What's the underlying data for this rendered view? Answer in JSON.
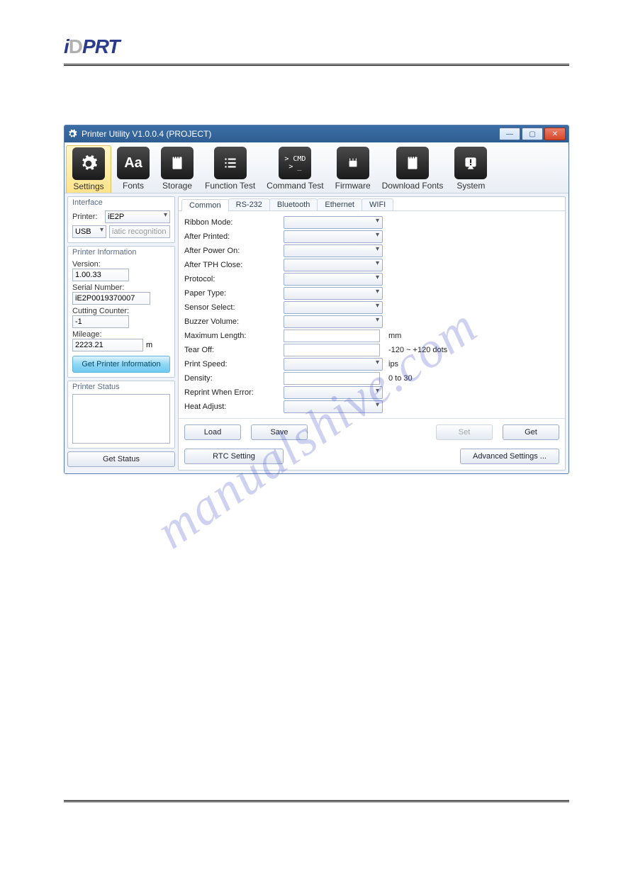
{
  "brand": "iDPRT",
  "title": "Printer Utility  V1.0.0.4  (PROJECT)",
  "watermark": "manualshive.com",
  "toolbar": [
    {
      "key": "settings",
      "label": "Settings"
    },
    {
      "key": "fonts",
      "label": "Fonts"
    },
    {
      "key": "storage",
      "label": "Storage"
    },
    {
      "key": "function_test",
      "label": "Function Test"
    },
    {
      "key": "command_test",
      "label": "Command Test"
    },
    {
      "key": "firmware",
      "label": "Firmware"
    },
    {
      "key": "download_fonts",
      "label": "Download Fonts"
    },
    {
      "key": "system",
      "label": "System"
    }
  ],
  "interface": {
    "title": "Interface",
    "printer_label": "Printer:",
    "printer_value": "iE2P",
    "conn": "USB",
    "conn_hint": "iatic recognition USB"
  },
  "printer_info": {
    "title": "Printer Information",
    "version_label": "Version:",
    "version_value": "1.00.33",
    "serial_label": "Serial Number:",
    "serial_value": "iE2P0019370007",
    "cutting_label": "Cutting Counter:",
    "cutting_value": "-1",
    "mileage_label": "Mileage:",
    "mileage_value": "2223.21",
    "mileage_unit": "m",
    "get_info_btn": "Get Printer Information"
  },
  "status": {
    "title": "Printer Status",
    "get_status_btn": "Get Status"
  },
  "tabs": [
    {
      "label": "Common"
    },
    {
      "label": "RS-232"
    },
    {
      "label": "Bluetooth"
    },
    {
      "label": "Ethernet"
    },
    {
      "label": "WIFI"
    }
  ],
  "fields": [
    {
      "label": "Ribbon Mode:",
      "type": "combo"
    },
    {
      "label": "After Printed:",
      "type": "combo"
    },
    {
      "label": "After Power On:",
      "type": "combo"
    },
    {
      "label": "After TPH Close:",
      "type": "combo"
    },
    {
      "label": "Protocol:",
      "type": "combo"
    },
    {
      "label": "Paper Type:",
      "type": "combo"
    },
    {
      "label": "Sensor Select:",
      "type": "combo"
    },
    {
      "label": "Buzzer Volume:",
      "type": "combo"
    },
    {
      "label": "Maximum Length:",
      "type": "text",
      "unit": "mm"
    },
    {
      "label": "Tear Off:",
      "type": "text",
      "unit": "-120 ~ +120 dots"
    },
    {
      "label": "Print Speed:",
      "type": "combo",
      "unit": "ips"
    },
    {
      "label": "Density:",
      "type": "text",
      "unit": "0 to 30"
    },
    {
      "label": "Reprint When Error:",
      "type": "combo"
    },
    {
      "label": "Heat Adjust:",
      "type": "combo"
    }
  ],
  "buttons": {
    "load": "Load",
    "save": "Save",
    "set": "Set",
    "get": "Get",
    "rtc": "RTC Setting",
    "adv": "Advanced Settings ..."
  },
  "cmd_text": "> CMD\n> _"
}
